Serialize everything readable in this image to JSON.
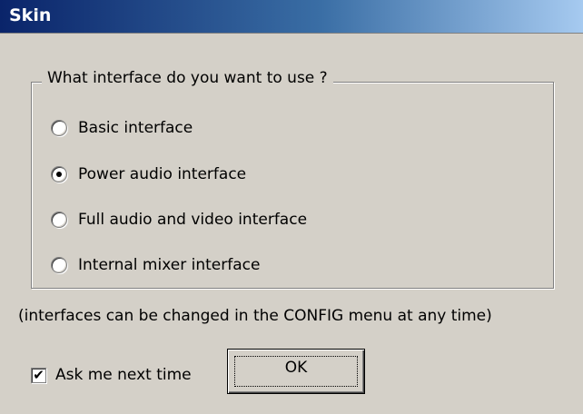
{
  "window": {
    "title": "Skin"
  },
  "group": {
    "legend": "What interface do you want to use ?",
    "options": [
      {
        "label": "Basic interface",
        "checked": false
      },
      {
        "label": "Power audio interface",
        "checked": true
      },
      {
        "label": "Full audio and video interface",
        "checked": false
      },
      {
        "label": "Internal mixer interface",
        "checked": false
      }
    ]
  },
  "note": "(interfaces can be changed in the CONFIG menu at any time)",
  "ask_next_time": {
    "label": "Ask me next time",
    "checked": true,
    "check_glyph": "✔"
  },
  "buttons": {
    "ok": "OK"
  },
  "colors": {
    "dialog_bg": "#d4d0c8",
    "title_gradient_start": "#0a246a",
    "title_gradient_end": "#a6caf0"
  }
}
